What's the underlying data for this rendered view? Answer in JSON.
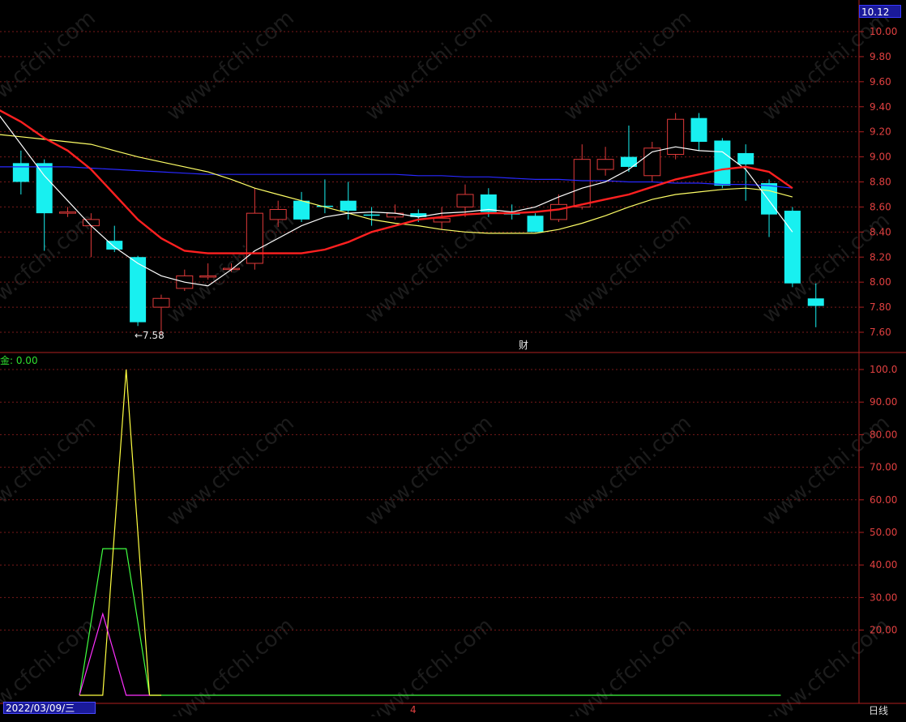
{
  "price_box": "10.12",
  "indicator_label": "金: 0.00",
  "low_annotation": "←7.58",
  "finance_marker": "财",
  "date_box": "2022/03/09/三",
  "x_marker": "4",
  "period_label": "日线",
  "colors": {
    "up": "#e03a3a",
    "down": "#18f0f0",
    "ma_fast": "#ffffff",
    "ma_mid": "#ff2020",
    "ma_slow": "#ffff66",
    "ma_long": "#2828ff",
    "ind_yellow": "#ffff40",
    "ind_green": "#40ff40",
    "ind_magenta": "#ff30ff"
  },
  "chart_data": [
    {
      "type": "candlestick",
      "y_ticks": [
        "7.60",
        "7.80",
        "8.00",
        "8.20",
        "8.40",
        "8.60",
        "8.80",
        "9.00",
        "9.20",
        "9.40",
        "9.60",
        "9.80",
        "10.00"
      ],
      "ylim": [
        7.53,
        10.12
      ],
      "candles": [
        {
          "o": 8.95,
          "c": 8.8,
          "h": 9.05,
          "l": 8.7
        },
        {
          "o": 8.95,
          "c": 8.55,
          "h": 8.98,
          "l": 8.25
        },
        {
          "o": 8.55,
          "c": 8.56,
          "h": 8.6,
          "l": 8.52
        },
        {
          "o": 8.45,
          "c": 8.5,
          "h": 8.55,
          "l": 8.2
        },
        {
          "o": 8.33,
          "c": 8.26,
          "h": 8.45,
          "l": 8.24
        },
        {
          "o": 8.2,
          "c": 7.68,
          "h": 8.21,
          "l": 7.65
        },
        {
          "o": 7.8,
          "c": 7.87,
          "h": 7.9,
          "l": 7.58
        },
        {
          "o": 7.95,
          "c": 8.05,
          "h": 8.1,
          "l": 7.93
        },
        {
          "o": 8.04,
          "c": 8.05,
          "h": 8.15,
          "l": 8.02
        },
        {
          "o": 8.11,
          "c": 8.11,
          "h": 8.15,
          "l": 8.08
        },
        {
          "o": 8.15,
          "c": 8.55,
          "h": 8.75,
          "l": 8.1
        },
        {
          "o": 8.5,
          "c": 8.58,
          "h": 8.65,
          "l": 8.44
        },
        {
          "o": 8.65,
          "c": 8.5,
          "h": 8.72,
          "l": 8.48
        },
        {
          "o": 8.61,
          "c": 8.6,
          "h": 8.82,
          "l": 8.55
        },
        {
          "o": 8.65,
          "c": 8.57,
          "h": 8.8,
          "l": 8.5
        },
        {
          "o": 8.54,
          "c": 8.53,
          "h": 8.6,
          "l": 8.45
        },
        {
          "o": 8.52,
          "c": 8.55,
          "h": 8.62,
          "l": 8.5
        },
        {
          "o": 8.55,
          "c": 8.52,
          "h": 8.58,
          "l": 8.48
        },
        {
          "o": 8.48,
          "c": 8.51,
          "h": 8.6,
          "l": 8.42
        },
        {
          "o": 8.6,
          "c": 8.7,
          "h": 8.78,
          "l": 8.52
        },
        {
          "o": 8.7,
          "c": 8.56,
          "h": 8.75,
          "l": 8.52
        },
        {
          "o": 8.55,
          "c": 8.54,
          "h": 8.62,
          "l": 8.5
        },
        {
          "o": 8.53,
          "c": 8.4,
          "h": 8.55,
          "l": 8.4
        },
        {
          "o": 8.5,
          "c": 8.62,
          "h": 8.7,
          "l": 8.48
        },
        {
          "o": 8.6,
          "c": 8.98,
          "h": 9.1,
          "l": 8.58
        },
        {
          "o": 8.9,
          "c": 8.98,
          "h": 9.08,
          "l": 8.85
        },
        {
          "o": 9.0,
          "c": 8.92,
          "h": 9.25,
          "l": 8.88
        },
        {
          "o": 8.85,
          "c": 9.07,
          "h": 9.12,
          "l": 8.8
        },
        {
          "o": 9.02,
          "c": 9.3,
          "h": 9.35,
          "l": 8.98
        },
        {
          "o": 9.31,
          "c": 9.12,
          "h": 9.35,
          "l": 9.05
        },
        {
          "o": 9.13,
          "c": 8.77,
          "h": 9.15,
          "l": 8.75
        },
        {
          "o": 9.03,
          "c": 8.94,
          "h": 9.1,
          "l": 8.65
        },
        {
          "o": 8.79,
          "c": 8.54,
          "h": 8.82,
          "l": 8.36
        },
        {
          "o": 8.57,
          "c": 7.99,
          "h": 8.6,
          "l": 7.96
        },
        {
          "o": 7.87,
          "c": 7.81,
          "h": 7.99,
          "l": 7.64
        }
      ],
      "ma_fast": [
        9.35,
        9.1,
        8.85,
        8.65,
        8.45,
        8.28,
        8.15,
        8.05,
        8.0,
        7.97,
        8.1,
        8.25,
        8.35,
        8.45,
        8.52,
        8.55,
        8.56,
        8.55,
        8.52,
        8.55,
        8.56,
        8.58,
        8.56,
        8.6,
        8.68,
        8.75,
        8.8,
        8.9,
        9.04,
        9.08,
        9.05,
        9.04,
        8.9,
        8.65,
        8.4
      ],
      "ma_mid": [
        9.38,
        9.28,
        9.15,
        9.05,
        8.9,
        8.7,
        8.5,
        8.35,
        8.25,
        8.23,
        8.23,
        8.23,
        8.23,
        8.23,
        8.26,
        8.32,
        8.4,
        8.45,
        8.5,
        8.52,
        8.54,
        8.55,
        8.55,
        8.56,
        8.58,
        8.62,
        8.66,
        8.7,
        8.76,
        8.82,
        8.86,
        8.9,
        8.92,
        8.88,
        8.75
      ],
      "ma_slow": [
        9.18,
        9.16,
        9.14,
        9.12,
        9.1,
        9.05,
        9.0,
        8.96,
        8.92,
        8.88,
        8.82,
        8.75,
        8.7,
        8.65,
        8.6,
        8.55,
        8.5,
        8.47,
        8.45,
        8.42,
        8.4,
        8.39,
        8.39,
        8.39,
        8.42,
        8.47,
        8.53,
        8.6,
        8.66,
        8.7,
        8.72,
        8.74,
        8.75,
        8.73,
        8.68
      ],
      "ma_long": [
        8.92,
        8.92,
        8.92,
        8.92,
        8.91,
        8.9,
        8.89,
        8.88,
        8.87,
        8.86,
        8.86,
        8.86,
        8.86,
        8.86,
        8.86,
        8.86,
        8.86,
        8.86,
        8.85,
        8.85,
        8.84,
        8.84,
        8.83,
        8.82,
        8.82,
        8.81,
        8.81,
        8.8,
        8.8,
        8.79,
        8.79,
        8.78,
        8.78,
        8.77,
        8.75
      ]
    },
    {
      "type": "line",
      "y_ticks": [
        "20.00",
        "30.00",
        "40.00",
        "50.00",
        "60.00",
        "70.00",
        "80.00",
        "90.00",
        "100.0"
      ],
      "ylim": [
        0,
        102
      ],
      "series_yellow": [
        [
          3.5,
          0
        ],
        [
          4.5,
          0
        ],
        [
          5.5,
          100
        ],
        [
          6.5,
          0
        ],
        [
          7,
          0
        ]
      ],
      "series_green": [
        [
          3.5,
          0
        ],
        [
          4.5,
          45
        ],
        [
          5.5,
          45
        ],
        [
          6.5,
          0
        ],
        [
          33.5,
          0
        ]
      ],
      "series_magenta": [
        [
          3.5,
          0
        ],
        [
          4.5,
          25
        ],
        [
          5.5,
          0
        ],
        [
          6.5,
          0
        ]
      ]
    }
  ]
}
